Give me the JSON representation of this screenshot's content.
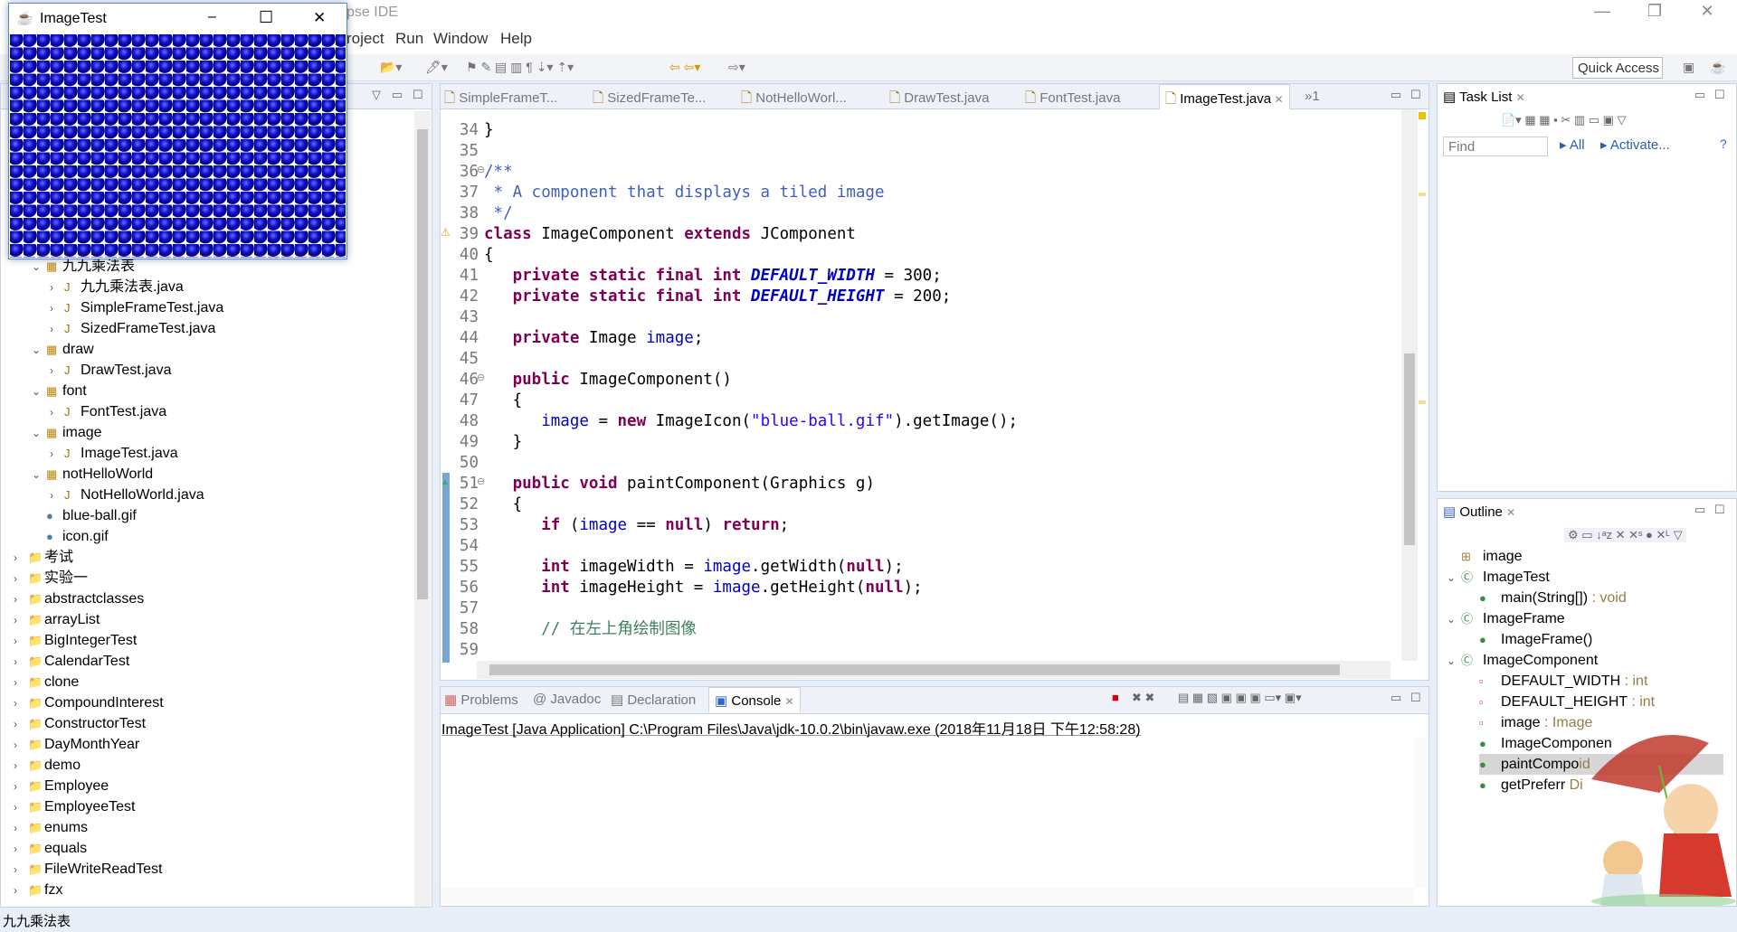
{
  "eclipse": {
    "title_partial": "pse IDE",
    "menu": [
      "roject",
      "Run",
      "Window",
      "Help"
    ],
    "quick_access": "Quick Access"
  },
  "image_window": {
    "title": "ImageTest",
    "minimize": "–",
    "maximize": "☐",
    "close": "✕"
  },
  "package_explorer": {
    "items": [
      {
        "label": "九九乘法表",
        "level": 1,
        "type": "package",
        "expanded": true
      },
      {
        "label": "九九乘法表.java",
        "level": 2,
        "type": "java"
      },
      {
        "label": "SimpleFrameTest.java",
        "level": 2,
        "type": "java"
      },
      {
        "label": "SizedFrameTest.java",
        "level": 2,
        "type": "java"
      },
      {
        "label": "draw",
        "level": 1,
        "type": "package",
        "expanded": true
      },
      {
        "label": "DrawTest.java",
        "level": 2,
        "type": "java"
      },
      {
        "label": "font",
        "level": 1,
        "type": "package",
        "expanded": true
      },
      {
        "label": "FontTest.java",
        "level": 2,
        "type": "java"
      },
      {
        "label": "image",
        "level": 1,
        "type": "package",
        "expanded": true
      },
      {
        "label": "ImageTest.java",
        "level": 2,
        "type": "java"
      },
      {
        "label": "notHelloWorld",
        "level": 1,
        "type": "package",
        "expanded": true
      },
      {
        "label": "NotHelloWorld.java",
        "level": 2,
        "type": "java"
      },
      {
        "label": "blue-ball.gif",
        "level": 1,
        "type": "file"
      },
      {
        "label": "icon.gif",
        "level": 1,
        "type": "file"
      },
      {
        "label": "考试",
        "level": 0,
        "type": "project"
      },
      {
        "label": "实验一",
        "level": 0,
        "type": "project"
      },
      {
        "label": "abstractclasses",
        "level": 0,
        "type": "project"
      },
      {
        "label": "arrayList",
        "level": 0,
        "type": "project"
      },
      {
        "label": "BigIntegerTest",
        "level": 0,
        "type": "project"
      },
      {
        "label": "CalendarTest",
        "level": 0,
        "type": "project"
      },
      {
        "label": "clone",
        "level": 0,
        "type": "project"
      },
      {
        "label": "CompoundInterest",
        "level": 0,
        "type": "project"
      },
      {
        "label": "ConstructorTest",
        "level": 0,
        "type": "project"
      },
      {
        "label": "DayMonthYear",
        "level": 0,
        "type": "project"
      },
      {
        "label": "demo",
        "level": 0,
        "type": "project"
      },
      {
        "label": "Employee",
        "level": 0,
        "type": "project"
      },
      {
        "label": "EmployeeTest",
        "level": 0,
        "type": "project"
      },
      {
        "label": "enums",
        "level": 0,
        "type": "project"
      },
      {
        "label": "equals",
        "level": 0,
        "type": "project"
      },
      {
        "label": "FileWriteReadTest",
        "level": 0,
        "type": "project"
      },
      {
        "label": "fzx",
        "level": 0,
        "type": "project"
      }
    ]
  },
  "editor": {
    "tabs": [
      {
        "label": "SimpleFrameT...",
        "active": false
      },
      {
        "label": "SizedFrameTe...",
        "active": false
      },
      {
        "label": "NotHelloWorl...",
        "active": false
      },
      {
        "label": "DrawTest.java",
        "active": false
      },
      {
        "label": "FontTest.java",
        "active": false
      },
      {
        "label": "ImageTest.java",
        "active": true
      }
    ],
    "overflow": "»1",
    "lines": [
      {
        "n": "34",
        "seg": [
          [
            "}",
            ""
          ]
        ]
      },
      {
        "n": "35",
        "seg": []
      },
      {
        "n": "36",
        "fold": true,
        "seg": [
          [
            "/**",
            "cm"
          ]
        ]
      },
      {
        "n": "37",
        "seg": [
          [
            " * A component that displays a tiled image",
            "cm"
          ]
        ]
      },
      {
        "n": "38",
        "seg": [
          [
            " */",
            "cm"
          ]
        ]
      },
      {
        "n": "39",
        "warn": true,
        "seg": [
          [
            "class",
            "kw"
          ],
          [
            " ImageComponent ",
            ""
          ],
          [
            "extends",
            "kw"
          ],
          [
            " JComponent",
            ""
          ]
        ]
      },
      {
        "n": "40",
        "seg": [
          [
            "{",
            ""
          ]
        ]
      },
      {
        "n": "41",
        "seg": [
          [
            "   ",
            ""
          ],
          [
            "private static final int",
            "kw"
          ],
          [
            " ",
            ""
          ],
          [
            "DEFAULT_WIDTH",
            "cst"
          ],
          [
            " = 300;",
            ""
          ]
        ]
      },
      {
        "n": "42",
        "seg": [
          [
            "   ",
            ""
          ],
          [
            "private static final int",
            "kw"
          ],
          [
            " ",
            ""
          ],
          [
            "DEFAULT_HEIGHT",
            "cst"
          ],
          [
            " = 200;",
            ""
          ]
        ]
      },
      {
        "n": "43",
        "seg": []
      },
      {
        "n": "44",
        "seg": [
          [
            "   ",
            ""
          ],
          [
            "private",
            "kw"
          ],
          [
            " Image ",
            ""
          ],
          [
            "image",
            "fld"
          ],
          [
            ";",
            ""
          ]
        ]
      },
      {
        "n": "45",
        "seg": []
      },
      {
        "n": "46",
        "fold": true,
        "seg": [
          [
            "   ",
            ""
          ],
          [
            "public",
            "kw"
          ],
          [
            " ImageComponent()",
            ""
          ]
        ]
      },
      {
        "n": "47",
        "seg": [
          [
            "   {",
            ""
          ]
        ]
      },
      {
        "n": "48",
        "seg": [
          [
            "      ",
            ""
          ],
          [
            "image",
            "fld"
          ],
          [
            " = ",
            ""
          ],
          [
            "new",
            "kw"
          ],
          [
            " ImageIcon(",
            ""
          ],
          [
            "\"blue-ball.gif\"",
            "str"
          ],
          [
            ").getImage();",
            ""
          ]
        ]
      },
      {
        "n": "49",
        "seg": [
          [
            "   }",
            ""
          ]
        ]
      },
      {
        "n": "50",
        "seg": []
      },
      {
        "n": "51",
        "fold": true,
        "override": true,
        "seg": [
          [
            "   ",
            ""
          ],
          [
            "public void",
            "kw"
          ],
          [
            " paintComponent(Graphics g)",
            ""
          ]
        ]
      },
      {
        "n": "52",
        "seg": [
          [
            "   {",
            ""
          ]
        ]
      },
      {
        "n": "53",
        "seg": [
          [
            "      ",
            ""
          ],
          [
            "if",
            "kw"
          ],
          [
            " (",
            ""
          ],
          [
            "image",
            "fld"
          ],
          [
            " == ",
            ""
          ],
          [
            "null",
            "kw"
          ],
          [
            ") ",
            ""
          ],
          [
            "return",
            "kw"
          ],
          [
            ";",
            ""
          ]
        ]
      },
      {
        "n": "54",
        "seg": []
      },
      {
        "n": "55",
        "seg": [
          [
            "      ",
            ""
          ],
          [
            "int",
            "kw"
          ],
          [
            " imageWidth = ",
            ""
          ],
          [
            "image",
            "fld"
          ],
          [
            ".getWidth(",
            ""
          ],
          [
            "null",
            "kw"
          ],
          [
            ");",
            ""
          ]
        ]
      },
      {
        "n": "56",
        "seg": [
          [
            "      ",
            ""
          ],
          [
            "int",
            "kw"
          ],
          [
            " imageHeight = ",
            ""
          ],
          [
            "image",
            "fld"
          ],
          [
            ".getHeight(",
            ""
          ],
          [
            "null",
            "kw"
          ],
          [
            ");",
            ""
          ]
        ]
      },
      {
        "n": "57",
        "seg": []
      },
      {
        "n": "58",
        "seg": [
          [
            "      ",
            ""
          ],
          [
            "// 在左上角绘制图像",
            "lc"
          ]
        ]
      },
      {
        "n": "59",
        "seg": []
      }
    ]
  },
  "console": {
    "tabs": [
      "Problems",
      "Javadoc",
      "Declaration",
      "Console"
    ],
    "active": "Console",
    "status": "ImageTest [Java Application] C:\\Program Files\\Java\\jdk-10.0.2\\bin\\javaw.exe (2018年11月18日 下午12:58:28)"
  },
  "tasklist": {
    "title": "Task List",
    "find_placeholder": "Find",
    "all": "All",
    "activate": "Activate..."
  },
  "outline": {
    "title": "Outline",
    "items": [
      {
        "label": "image",
        "type": "",
        "level": 0,
        "icon": "import-icon"
      },
      {
        "label": "ImageTest",
        "type": "",
        "level": 0,
        "icon": "class-icon",
        "chev": true
      },
      {
        "label": "main(String[])",
        "type": " : void",
        "level": 1,
        "icon": "method-public-static-icon"
      },
      {
        "label": "ImageFrame",
        "type": "",
        "level": 0,
        "icon": "class-warning-icon",
        "chev": true
      },
      {
        "label": "ImageFrame()",
        "type": "",
        "level": 1,
        "icon": "constructor-icon"
      },
      {
        "label": "ImageComponent",
        "type": "",
        "level": 0,
        "icon": "class-warning-icon",
        "chev": true
      },
      {
        "label": "DEFAULT_WIDTH",
        "type": " : int",
        "level": 1,
        "icon": "field-private-static-final-icon"
      },
      {
        "label": "DEFAULT_HEIGHT",
        "type": " : int",
        "level": 1,
        "icon": "field-private-static-final-icon"
      },
      {
        "label": "image",
        "type": " : Image",
        "level": 1,
        "icon": "field-private-icon"
      },
      {
        "label": "ImageComponen",
        "type": "",
        "level": 1,
        "icon": "constructor-icon"
      },
      {
        "label": "paintCompo",
        "type": "id",
        "level": 1,
        "icon": "method-override-icon",
        "selected": true
      },
      {
        "label": "getPreferr",
        "type": " Di",
        "level": 1,
        "icon": "method-override-icon"
      }
    ]
  },
  "statusbar": {
    "text": "九九乘法表"
  },
  "colors": {
    "keyword": "#7f0055",
    "field": "#0000c0",
    "string": "#2a00ff",
    "comment": "#3f5fbf",
    "line_comment": "#3f7f5f",
    "ball": "#1010c8"
  }
}
